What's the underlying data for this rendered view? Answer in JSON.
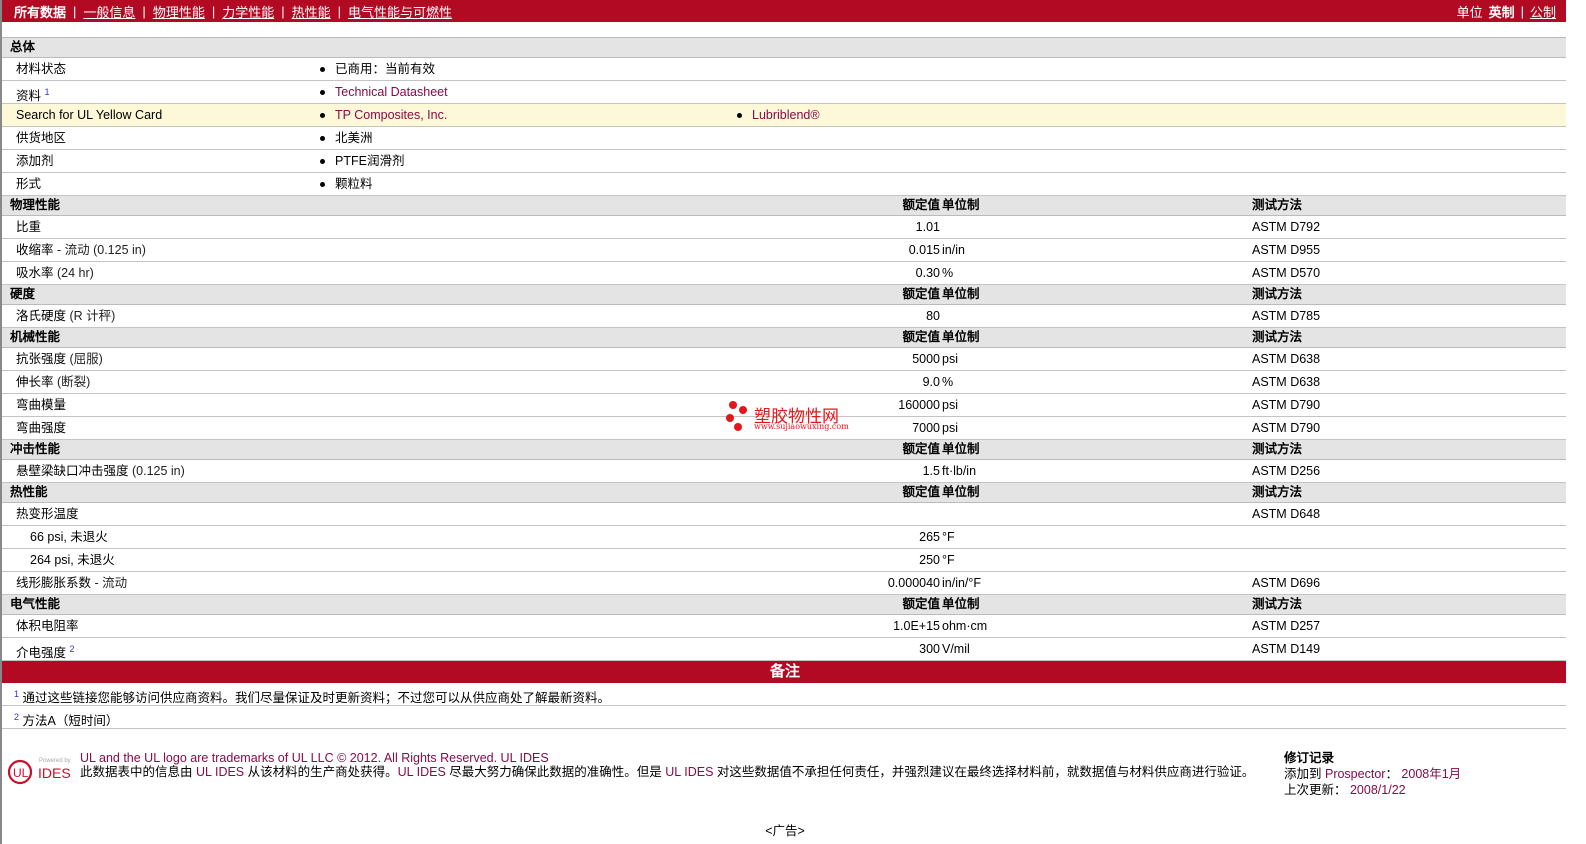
{
  "nav": {
    "tabs": [
      "所有数据",
      "一般信息",
      "物理性能",
      "力学性能",
      "热性能",
      "电气性能与可燃性"
    ],
    "unit_label": "单位",
    "unit_imperial": "英制",
    "unit_metric": "公制"
  },
  "general": {
    "title": "总体",
    "rows": [
      {
        "name": "材料状态",
        "values": [
          "已商用：当前有效"
        ],
        "link": false
      },
      {
        "name": "资料",
        "sup": "1",
        "values": [
          "Technical Datasheet"
        ],
        "link": true
      },
      {
        "name": "Search for UL Yellow Card",
        "values": [
          "TP Composites, Inc.",
          "Lubriblend®"
        ],
        "link": true,
        "highlight": true
      },
      {
        "name": "供货地区",
        "values": [
          "北美洲"
        ],
        "link": false
      },
      {
        "name": "添加剂",
        "values": [
          "PTFE润滑剂"
        ],
        "link": false
      },
      {
        "name": "形式",
        "values": [
          "颗粒料"
        ],
        "link": false
      }
    ]
  },
  "col_headers": {
    "value": "额定值",
    "unit": "单位制",
    "method": "测试方法"
  },
  "sections": [
    {
      "title": "物理性能",
      "rows": [
        {
          "name": "比重",
          "value": "1.01",
          "unit": "",
          "method": "ASTM D792"
        },
        {
          "name": "收缩率",
          "cond": " - 流动  (0.125 in)",
          "value": "0.015",
          "unit": "in/in",
          "method": "ASTM D955"
        },
        {
          "name": "吸水率",
          "cond": "  (24 hr)",
          "value": "0.30",
          "unit": "%",
          "method": "ASTM D570"
        }
      ]
    },
    {
      "title": "硬度",
      "rows": [
        {
          "name": "洛氏硬度",
          "cond": "  (R 计秤)",
          "value": "80",
          "unit": "",
          "method": "ASTM D785"
        }
      ]
    },
    {
      "title": "机械性能",
      "rows": [
        {
          "name": "抗张强度",
          "cond": "  (屈服)",
          "value": "5000",
          "unit": "psi",
          "method": "ASTM D638"
        },
        {
          "name": "伸长率",
          "cond": "  (断裂)",
          "value": "9.0",
          "unit": "%",
          "method": "ASTM D638"
        },
        {
          "name": "弯曲模量",
          "value": "160000",
          "unit": "psi",
          "method": "ASTM D790"
        },
        {
          "name": "弯曲强度",
          "value": "7000",
          "unit": "psi",
          "method": "ASTM D790"
        }
      ]
    },
    {
      "title": "冲击性能",
      "rows": [
        {
          "name": "悬壁梁缺口冲击强度",
          "cond": "  (0.125 in)",
          "value": "1.5",
          "unit": "ft·lb/in",
          "method": "ASTM D256"
        }
      ]
    },
    {
      "title": "热性能",
      "rows": [
        {
          "name": "热变形温度",
          "value": "",
          "unit": "",
          "method": "ASTM D648"
        },
        {
          "name": "66 psi, 未退火",
          "indent": true,
          "value": "265",
          "unit": "°F",
          "method": ""
        },
        {
          "name": "264 psi, 未退火",
          "indent": true,
          "value": "250",
          "unit": "°F",
          "method": ""
        },
        {
          "name": "线形膨胀系数",
          "cond": "  - 流动",
          "value": "0.000040",
          "unit": "in/in/°F",
          "method": "ASTM D696"
        }
      ]
    },
    {
      "title": "电气性能",
      "rows": [
        {
          "name": "体积电阻率",
          "value": "1.0E+15",
          "unit": "ohm·cm",
          "method": "ASTM D257"
        },
        {
          "name": "介电强度",
          "sup": "2",
          "value": "300",
          "unit": "V/mil",
          "method": "ASTM D149"
        }
      ]
    }
  ],
  "notes": {
    "title": "备注",
    "items": [
      {
        "n": "1",
        "text": "通过这些链接您能够访问供应商资料。我们尽量保证及时更新资料；不过您可以从供应商处了解最新资料。"
      },
      {
        "n": "2",
        "text": "方法A（短时间）"
      }
    ]
  },
  "footer": {
    "logo_powered": "Powered by",
    "logo_ul": "UL",
    "logo_ides": "IDES",
    "trademark": "UL and the UL logo are trademarks of UL LLC © 2012. All Rights Reserved. UL IDES",
    "disclaimer_1": "此数据表中的信息由 ",
    "disclaimer_link1": "UL IDES",
    "disclaimer_2": " 从该材料的生产商处获得。",
    "disclaimer_link2": "UL IDES",
    "disclaimer_3": " 尽最大努力确保此数据的准确性。但是 ",
    "disclaimer_link3": "UL IDES",
    "disclaimer_4": " 对这些数据值不承担任何责任，并强烈建议在最终选择材料前，就数据值与材料供应商进行验证。",
    "rev_title": "修订记录",
    "added_label": "添加到 ",
    "added_link": "Prospector",
    "added_sep": "：  ",
    "added_date": "2008年1月",
    "updated_label": "上次更新：  ",
    "updated_date": "2008/1/22"
  },
  "watermark": {
    "name": "塑胶物性网",
    "url": "www.sujiaowuxing.com"
  },
  "ad": "<广告>",
  "colors": {
    "brand": "#b20a22",
    "link": "#8a0a4a",
    "header_bg": "#e4e4e4",
    "highlight": "#fdf8d8"
  }
}
